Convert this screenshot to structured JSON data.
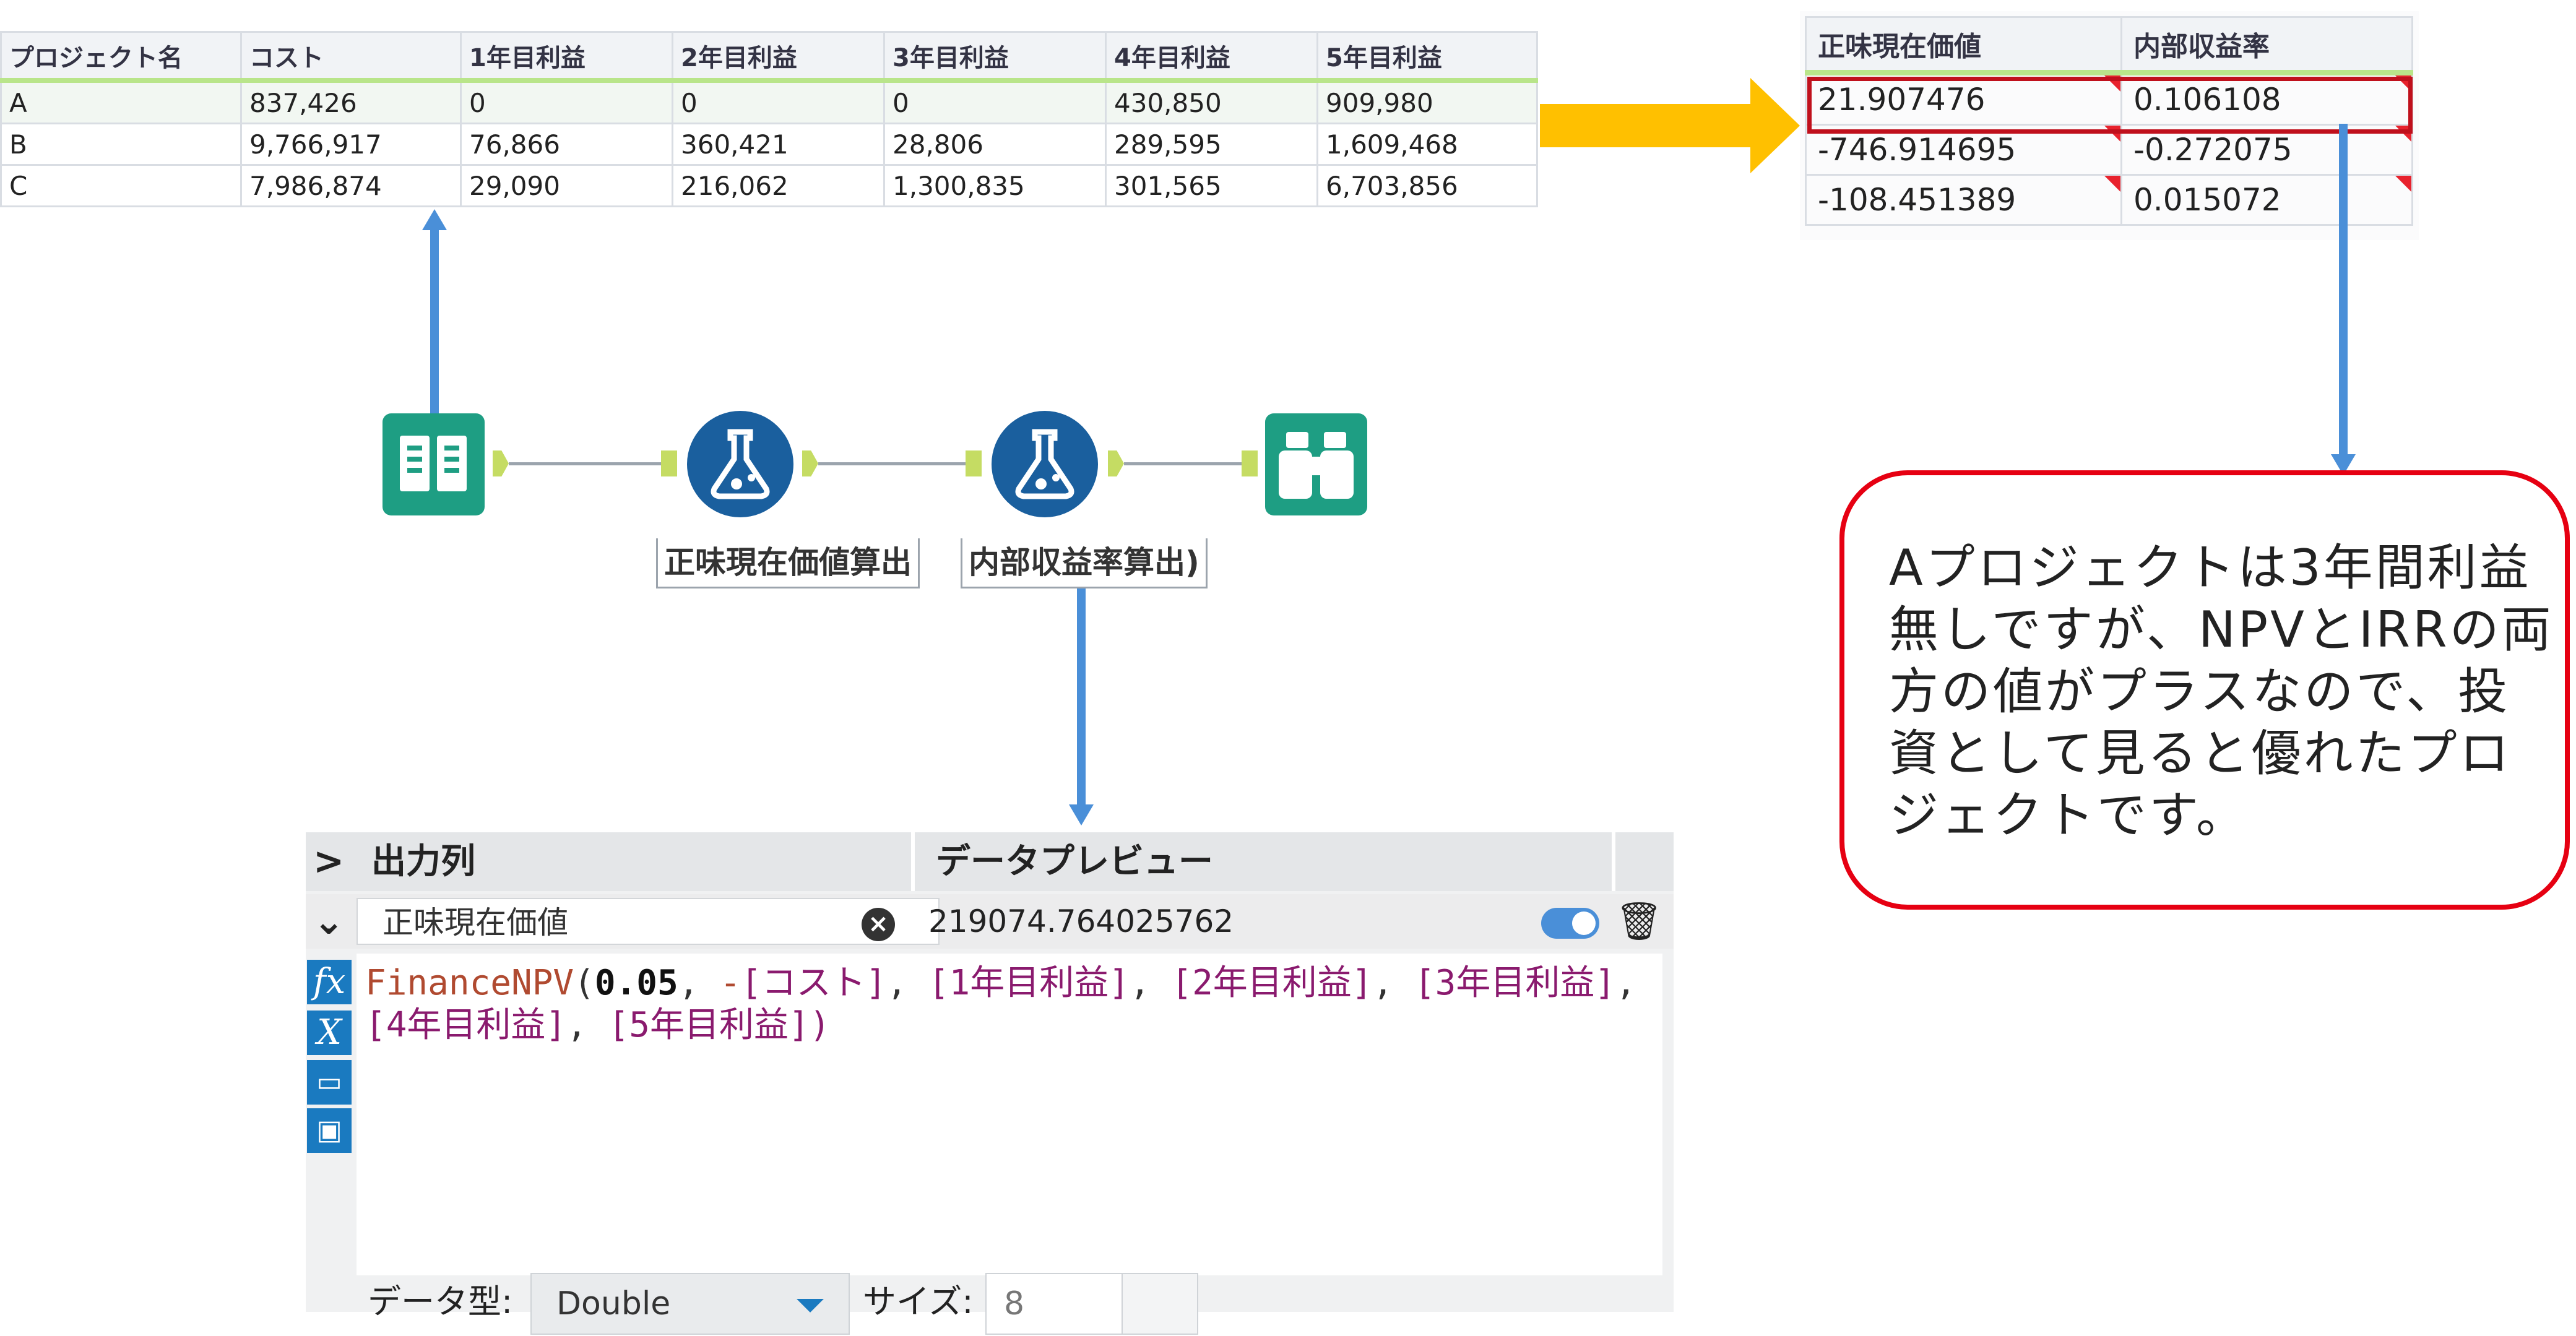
{
  "input_table": {
    "headers": [
      "プロジェクト名",
      "コスト",
      "1年目利益",
      "2年目利益",
      "3年目利益",
      "4年目利益",
      "5年目利益"
    ],
    "rows": [
      [
        "A",
        "837,426",
        "0",
        "0",
        "0",
        "430,850",
        "909,980"
      ],
      [
        "B",
        "9,766,917",
        "76,866",
        "360,421",
        "28,806",
        "289,595",
        "1,609,468"
      ],
      [
        "C",
        "7,986,874",
        "29,090",
        "216,062",
        "1,300,835",
        "301,565",
        "6,703,856"
      ]
    ]
  },
  "result_table": {
    "headers": [
      "正味現在価値",
      "内部収益率"
    ],
    "rows": [
      [
        "21.907476",
        "0.106108"
      ],
      [
        "-746.914695",
        "-0.272075"
      ],
      [
        "-108.451389",
        "0.015072"
      ]
    ]
  },
  "workflow": {
    "tools": [
      {
        "icon": "input-data-book-icon"
      },
      {
        "icon": "formula-flask-icon",
        "label": "正味現在価値算出"
      },
      {
        "icon": "formula-flask-icon",
        "label": "内部収益率算出)"
      },
      {
        "icon": "browse-binoculars-icon"
      }
    ]
  },
  "callout": {
    "text": "Aプロジェクトは3年間利益無しですが、NPVとIRRの両方の値がプラスなので、投資として見ると優れたプロジェクトです。"
  },
  "formula_panel": {
    "col_output": "出力列",
    "col_preview": "データプレビュー",
    "field_name": "正味現在価値",
    "preview_value": "219074.764025762",
    "formula": {
      "fn": "FinanceNPV",
      "open": "(",
      "rate": "0.05",
      "sep": ", ",
      "neg": "-",
      "fields": [
        "[コスト]",
        "[1年目利益]",
        "[2年目利益]",
        "[3年目利益]",
        "[4年目利益]",
        "[5年目利益]"
      ],
      "close": ")"
    },
    "data_type_label": "データ型:",
    "data_type_value": "Double",
    "size_label": "サイズ:",
    "size_value": "8"
  },
  "colors": {
    "accent_blue": "#4a8fd8",
    "arrow_yellow": "#ffc000",
    "callout_red": "#e60012",
    "tool_green": "#1e9e83",
    "tool_blue": "#1a5f9e"
  }
}
